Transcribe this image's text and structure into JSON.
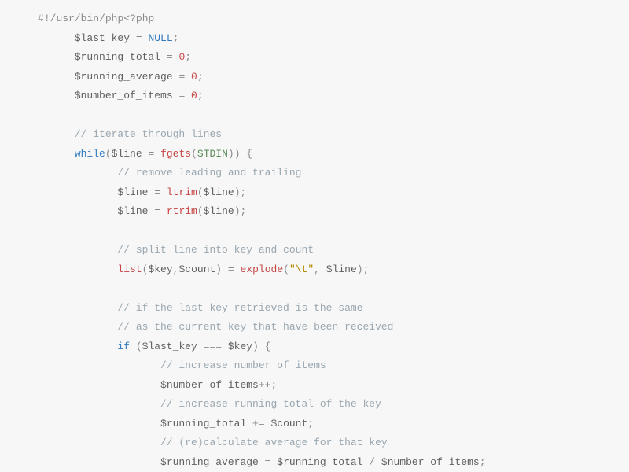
{
  "code": {
    "lines": [
      {
        "indent": 0,
        "tokens": [
          {
            "t": "#",
            "c": "punc"
          },
          {
            "t": "!",
            "c": "op"
          },
          {
            "t": "/",
            "c": "punc"
          },
          {
            "t": "usr",
            "c": "php"
          },
          {
            "t": "/",
            "c": "punc"
          },
          {
            "t": "bin",
            "c": "php"
          },
          {
            "t": "/",
            "c": "punc"
          },
          {
            "t": "php",
            "c": "php"
          },
          {
            "t": "<?",
            "c": "punc"
          },
          {
            "t": "php",
            "c": "php"
          }
        ]
      },
      {
        "indent": 1,
        "tokens": [
          {
            "t": "$last_key",
            "c": "var"
          },
          {
            "t": " = ",
            "c": "op"
          },
          {
            "t": "NULL",
            "c": "key"
          },
          {
            "t": ";",
            "c": "punc"
          }
        ]
      },
      {
        "indent": 1,
        "tokens": [
          {
            "t": "$running_total",
            "c": "var"
          },
          {
            "t": " = ",
            "c": "op"
          },
          {
            "t": "0",
            "c": "num"
          },
          {
            "t": ";",
            "c": "punc"
          }
        ]
      },
      {
        "indent": 1,
        "tokens": [
          {
            "t": "$running_average",
            "c": "var"
          },
          {
            "t": " = ",
            "c": "op"
          },
          {
            "t": "0",
            "c": "num"
          },
          {
            "t": ";",
            "c": "punc"
          }
        ]
      },
      {
        "indent": 1,
        "tokens": [
          {
            "t": "$number_of_items",
            "c": "var"
          },
          {
            "t": " = ",
            "c": "op"
          },
          {
            "t": "0",
            "c": "num"
          },
          {
            "t": ";",
            "c": "punc"
          }
        ]
      },
      {
        "indent": 0,
        "tokens": [
          {
            "t": " ",
            "c": "op"
          }
        ]
      },
      {
        "indent": 1,
        "tokens": [
          {
            "t": "// iterate through lines",
            "c": "comment"
          }
        ]
      },
      {
        "indent": 1,
        "tokens": [
          {
            "t": "while",
            "c": "key"
          },
          {
            "t": "(",
            "c": "punc"
          },
          {
            "t": "$line",
            "c": "var"
          },
          {
            "t": " = ",
            "c": "op"
          },
          {
            "t": "fgets",
            "c": "func"
          },
          {
            "t": "(",
            "c": "punc"
          },
          {
            "t": "STDIN",
            "c": "const"
          },
          {
            "t": ")",
            "c": "punc"
          },
          {
            "t": ")",
            "c": "punc"
          },
          {
            "t": " {",
            "c": "punc"
          }
        ]
      },
      {
        "indent": 2,
        "tokens": [
          {
            "t": "// remove leading and trailing",
            "c": "comment"
          }
        ]
      },
      {
        "indent": 2,
        "tokens": [
          {
            "t": "$line",
            "c": "var"
          },
          {
            "t": " = ",
            "c": "op"
          },
          {
            "t": "ltrim",
            "c": "func"
          },
          {
            "t": "(",
            "c": "punc"
          },
          {
            "t": "$line",
            "c": "var"
          },
          {
            "t": ")",
            "c": "punc"
          },
          {
            "t": ";",
            "c": "punc"
          }
        ]
      },
      {
        "indent": 2,
        "tokens": [
          {
            "t": "$line",
            "c": "var"
          },
          {
            "t": " = ",
            "c": "op"
          },
          {
            "t": "rtrim",
            "c": "func"
          },
          {
            "t": "(",
            "c": "punc"
          },
          {
            "t": "$line",
            "c": "var"
          },
          {
            "t": ")",
            "c": "punc"
          },
          {
            "t": ";",
            "c": "punc"
          }
        ]
      },
      {
        "indent": 0,
        "tokens": [
          {
            "t": " ",
            "c": "op"
          }
        ]
      },
      {
        "indent": 2,
        "tokens": [
          {
            "t": "// split line into key and count",
            "c": "comment"
          }
        ]
      },
      {
        "indent": 2,
        "tokens": [
          {
            "t": "list",
            "c": "func"
          },
          {
            "t": "(",
            "c": "punc"
          },
          {
            "t": "$key",
            "c": "var"
          },
          {
            "t": ",",
            "c": "punc"
          },
          {
            "t": "$count",
            "c": "var"
          },
          {
            "t": ")",
            "c": "punc"
          },
          {
            "t": " = ",
            "c": "op"
          },
          {
            "t": "explode",
            "c": "func"
          },
          {
            "t": "(",
            "c": "punc"
          },
          {
            "t": "\"\\t\"",
            "c": "str"
          },
          {
            "t": ", ",
            "c": "punc"
          },
          {
            "t": "$line",
            "c": "var"
          },
          {
            "t": ")",
            "c": "punc"
          },
          {
            "t": ";",
            "c": "punc"
          }
        ]
      },
      {
        "indent": 0,
        "tokens": [
          {
            "t": " ",
            "c": "op"
          }
        ]
      },
      {
        "indent": 2,
        "tokens": [
          {
            "t": "// if the last key retrieved is the same",
            "c": "comment"
          }
        ]
      },
      {
        "indent": 2,
        "tokens": [
          {
            "t": "// as the current key that have been received",
            "c": "comment"
          }
        ]
      },
      {
        "indent": 2,
        "tokens": [
          {
            "t": "if",
            "c": "key"
          },
          {
            "t": " (",
            "c": "punc"
          },
          {
            "t": "$last_key",
            "c": "var"
          },
          {
            "t": " === ",
            "c": "op"
          },
          {
            "t": "$key",
            "c": "var"
          },
          {
            "t": ")",
            "c": "punc"
          },
          {
            "t": " {",
            "c": "punc"
          }
        ]
      },
      {
        "indent": 3,
        "tokens": [
          {
            "t": "// increase number of items",
            "c": "comment"
          }
        ]
      },
      {
        "indent": 3,
        "tokens": [
          {
            "t": "$number_of_items",
            "c": "var"
          },
          {
            "t": "++",
            "c": "op"
          },
          {
            "t": ";",
            "c": "punc"
          }
        ]
      },
      {
        "indent": 3,
        "tokens": [
          {
            "t": "// increase running total of the key",
            "c": "comment"
          }
        ]
      },
      {
        "indent": 3,
        "tokens": [
          {
            "t": "$running_total",
            "c": "var"
          },
          {
            "t": " += ",
            "c": "op"
          },
          {
            "t": "$count",
            "c": "var"
          },
          {
            "t": ";",
            "c": "punc"
          }
        ]
      },
      {
        "indent": 3,
        "tokens": [
          {
            "t": "// (re)calculate average for that key",
            "c": "comment"
          }
        ]
      },
      {
        "indent": 3,
        "tokens": [
          {
            "t": "$running_average",
            "c": "var"
          },
          {
            "t": " = ",
            "c": "op"
          },
          {
            "t": "$running_total",
            "c": "var"
          },
          {
            "t": " / ",
            "c": "op"
          },
          {
            "t": "$number_of_items",
            "c": "var"
          },
          {
            "t": ";",
            "c": "punc"
          }
        ]
      }
    ]
  }
}
